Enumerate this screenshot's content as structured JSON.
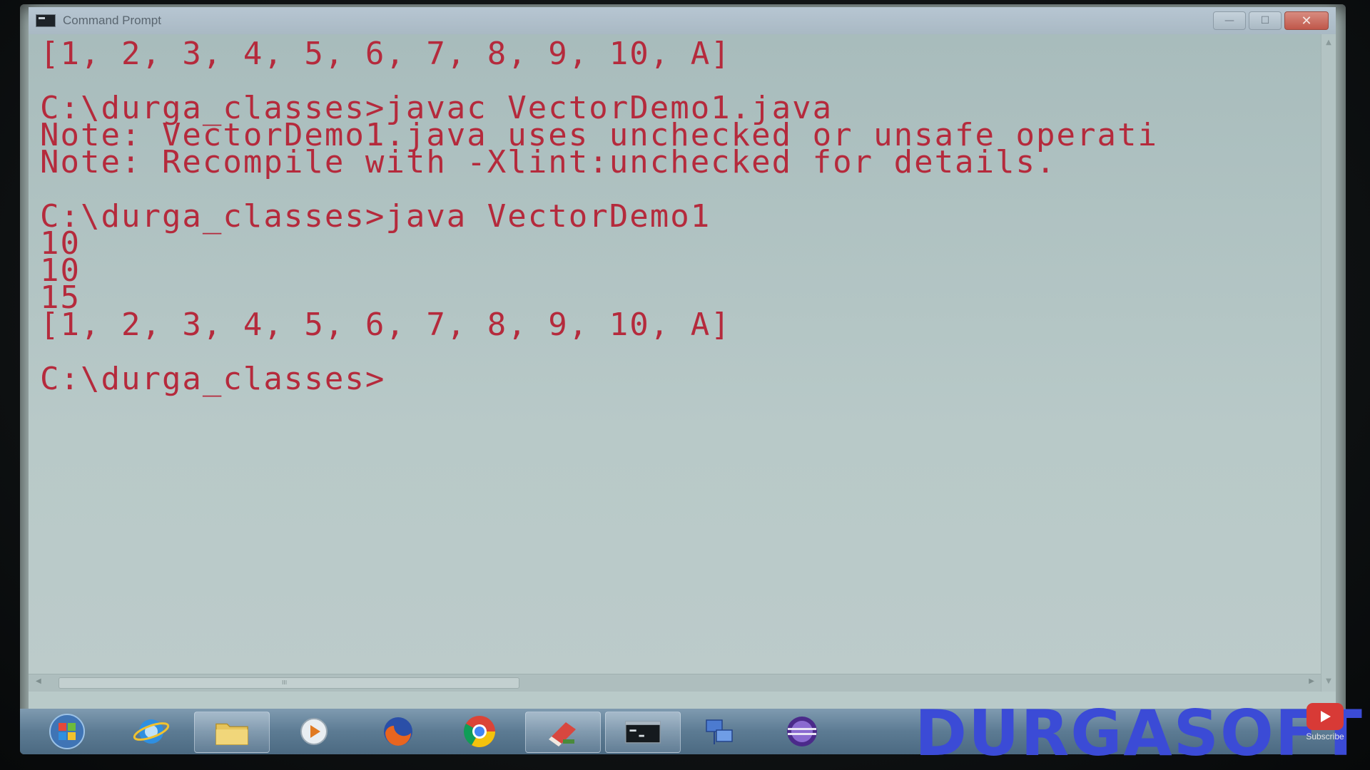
{
  "window": {
    "title": "Command Prompt",
    "minimize_label": "—",
    "maximize_label": "☐",
    "close_label": "✕"
  },
  "console": {
    "lines": [
      "[1, 2, 3, 4, 5, 6, 7, 8, 9, 10, A]",
      "",
      "C:\\durga_classes>javac VectorDemo1.java",
      "Note: VectorDemo1.java uses unchecked or unsafe operati",
      "Note: Recompile with -Xlint:unchecked for details.",
      "",
      "C:\\durga_classes>java VectorDemo1",
      "10",
      "10",
      "15",
      "[1, 2, 3, 4, 5, 6, 7, 8, 9, 10, A]",
      "",
      "C:\\durga_classes>"
    ]
  },
  "scrollbar": {
    "grip": "III"
  },
  "taskbar": {
    "items": [
      {
        "icon": "windows-start-icon"
      },
      {
        "icon": "internet-explorer-icon"
      },
      {
        "icon": "folder-icon"
      },
      {
        "icon": "media-player-icon"
      },
      {
        "icon": "firefox-icon"
      },
      {
        "icon": "chrome-icon"
      },
      {
        "icon": "eraser-app-icon"
      },
      {
        "icon": "command-prompt-icon"
      },
      {
        "icon": "network-icon"
      },
      {
        "icon": "eclipse-icon"
      }
    ]
  },
  "watermark": {
    "text": "DURGASOFT"
  },
  "youtube": {
    "subscribe_label": "Subscribe"
  },
  "colors": {
    "console_text": "#b52a3c",
    "console_bg": "#b3c5c4",
    "watermark": "#3b4bd6",
    "subscribe_red": "#d83a36"
  }
}
